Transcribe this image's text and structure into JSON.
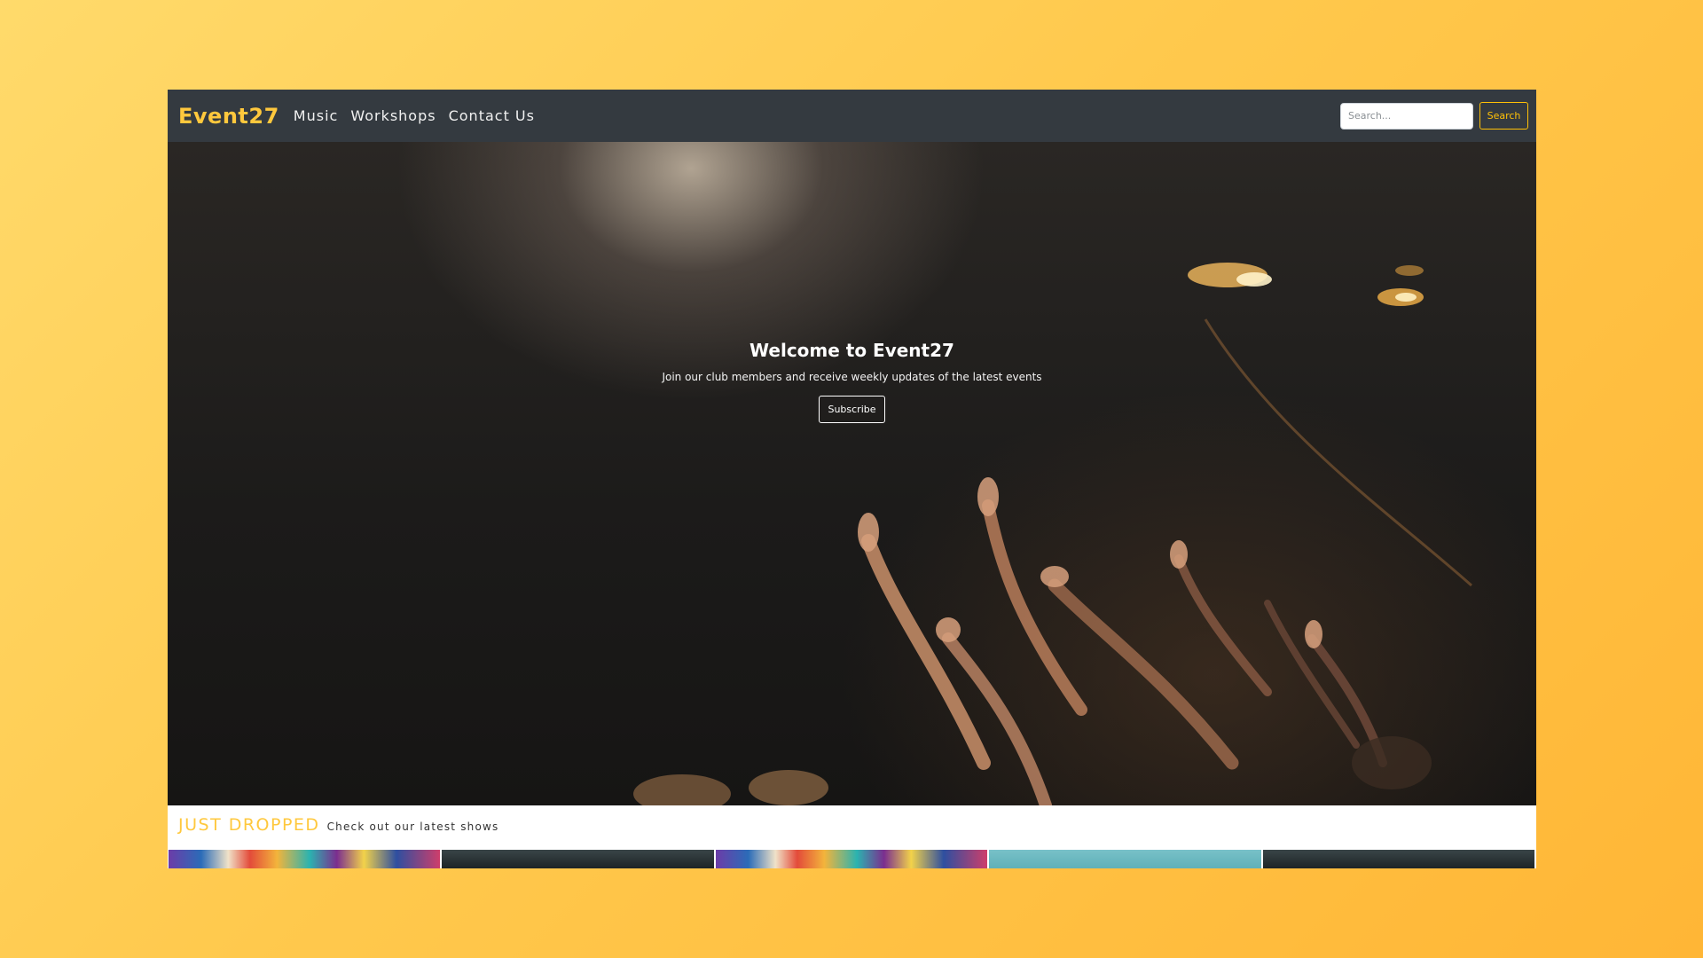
{
  "navbar": {
    "brand": "Event27",
    "links": [
      "Music",
      "Workshops",
      "Contact Us"
    ],
    "search_placeholder": "Search...",
    "search_button": "Search"
  },
  "hero": {
    "title": "Welcome to Event27",
    "subtitle": "Join our club members and receive weekly updates of the latest events",
    "subscribe_button": "Subscribe"
  },
  "section": {
    "title": "JUST DROPPED",
    "subtitle": "Check out our latest shows"
  },
  "colors": {
    "accent": "#ffc83d",
    "navbar": "#343a40",
    "background_gradient": [
      "#ffda6b",
      "#ffb636"
    ]
  },
  "thumbnails": [
    "show-poster",
    "show-stage-dark",
    "show-poster",
    "show-sky",
    "show-stage-dark"
  ]
}
